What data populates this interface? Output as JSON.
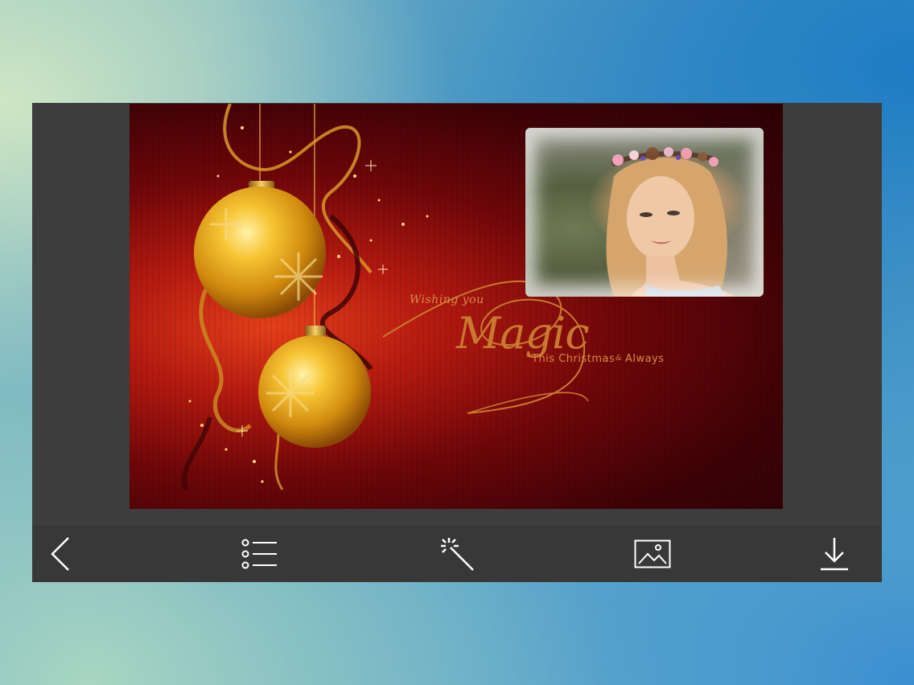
{
  "card": {
    "greeting_line1": "Wishing you",
    "greeting_big": "Magic",
    "greeting_line2": "This Christmas",
    "greeting_join": "&",
    "greeting_line3": "Always"
  },
  "toolbar": {
    "items": [
      {
        "name": "back",
        "icon": "chevron-left-icon"
      },
      {
        "name": "frames-list",
        "icon": "list-icon"
      },
      {
        "name": "effects",
        "icon": "magic-wand-icon"
      },
      {
        "name": "gallery",
        "icon": "image-icon"
      },
      {
        "name": "save",
        "icon": "download-icon"
      }
    ]
  },
  "colors": {
    "toolbar_bg": "#383838",
    "card_red": "#b51a10",
    "gold": "#f2b21e",
    "greeting_text": "#d98f3f"
  }
}
